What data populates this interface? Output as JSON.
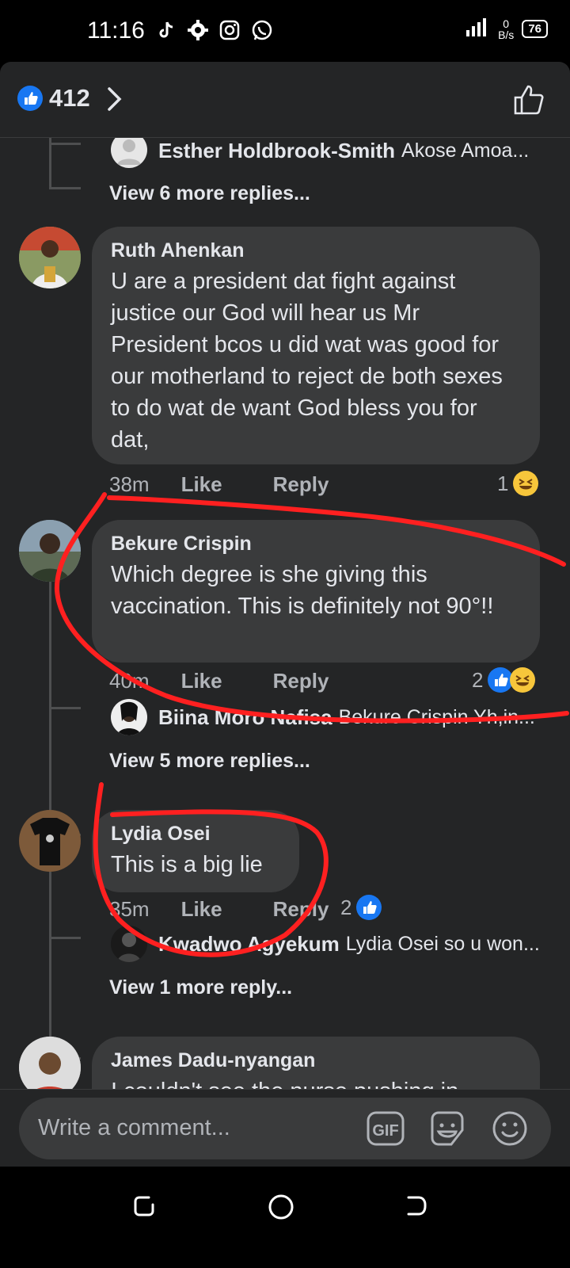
{
  "status": {
    "time": "11:16",
    "network_speed_value": "0",
    "network_speed_unit": "B/s",
    "battery": "76"
  },
  "header": {
    "like_count": "412"
  },
  "thread": {
    "reply_1": {
      "name": "Esther Holdbrook-Smith",
      "text": "Akose Amoa..."
    },
    "view_more_1": "View 6 more replies...",
    "comment_1": {
      "name": "Ruth Ahenkan",
      "text": "U are a president dat fight against justice our God will hear us Mr President bcos u did wat was good for our motherland to reject de both sexes to do wat de want God bless you for dat,",
      "time": "38m",
      "like": "Like",
      "reply": "Reply",
      "reaction_count": "1"
    },
    "comment_2": {
      "name": "Bekure Crispin",
      "text": "Which degree is she giving this vaccination. This is definitely not 90°!!",
      "time": "40m",
      "like": "Like",
      "reply": "Reply",
      "reaction_count": "2"
    },
    "reply_2": {
      "name": "Biina Moro Nafisa",
      "text": "Bekure Crispin Yh,in..."
    },
    "view_more_2": "View 5 more replies...",
    "comment_3": {
      "name": "Lydia Osei",
      "text": "This is a big lie",
      "time": "35m",
      "like": "Like",
      "reply": "Reply",
      "reaction_count": "2"
    },
    "reply_3": {
      "name": "Kwadwo Agyekum",
      "text": "Lydia Osei so u won..."
    },
    "view_more_3": "View 1 more reply...",
    "comment_4": {
      "name": "James Dadu-nyangan",
      "text": "I couldn't see the nurse pushing in..."
    }
  },
  "composer": {
    "placeholder": "Write a comment..."
  },
  "colors": {
    "background": "#242526",
    "bubble": "#3a3b3c",
    "like_blue": "#1877f2",
    "annotation_red": "#ff2020"
  }
}
